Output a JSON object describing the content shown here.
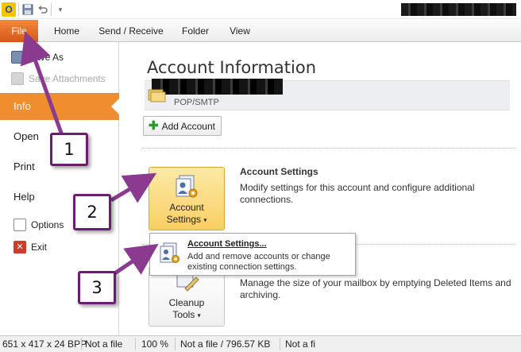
{
  "qat": {
    "app_logo": "O",
    "app_logo_icon": "outlook-logo-icon",
    "save_icon": "save-icon",
    "undo_icon": "undo-icon",
    "customize_icon": "customize-arrow-icon"
  },
  "tabs": [
    {
      "label": "File"
    },
    {
      "label": "Home"
    },
    {
      "label": "Send / Receive"
    },
    {
      "label": "Folder"
    },
    {
      "label": "View"
    }
  ],
  "nav": {
    "save_as": "Save As",
    "save_attachments": "Save Attachments",
    "info": "Info",
    "open": "Open",
    "print": "Print",
    "help": "Help",
    "options": "Options",
    "exit": "Exit"
  },
  "main": {
    "title": "Account Information",
    "account_type": "POP/SMTP",
    "add_account": "Add Account",
    "account_settings": {
      "button_line1": "Account",
      "button_line2": "Settings",
      "title": "Account Settings",
      "desc": "Modify settings for this account and configure additional connections."
    },
    "dropdown": {
      "title": "Account Settings...",
      "desc": "Add and remove accounts or change existing connection settings."
    },
    "cleanup": {
      "button_line1": "Cleanup",
      "button_line2": "Tools",
      "desc": "Manage the size of your mailbox by emptying Deleted Items and archiving."
    }
  },
  "statusbar": {
    "dimensions": "651 x 417 x 24 BPP",
    "file1": "Not a file",
    "zoom": "100 %",
    "file2": "Not a file / 796.57 KB",
    "file3": "Not a fi"
  },
  "callouts": [
    "1",
    "2",
    "3"
  ],
  "colors": {
    "file_tab": "#e0601f",
    "info_selected": "#ef8d2f",
    "callout_border": "#6a1f6e",
    "arrow": "#8a3b8f"
  }
}
